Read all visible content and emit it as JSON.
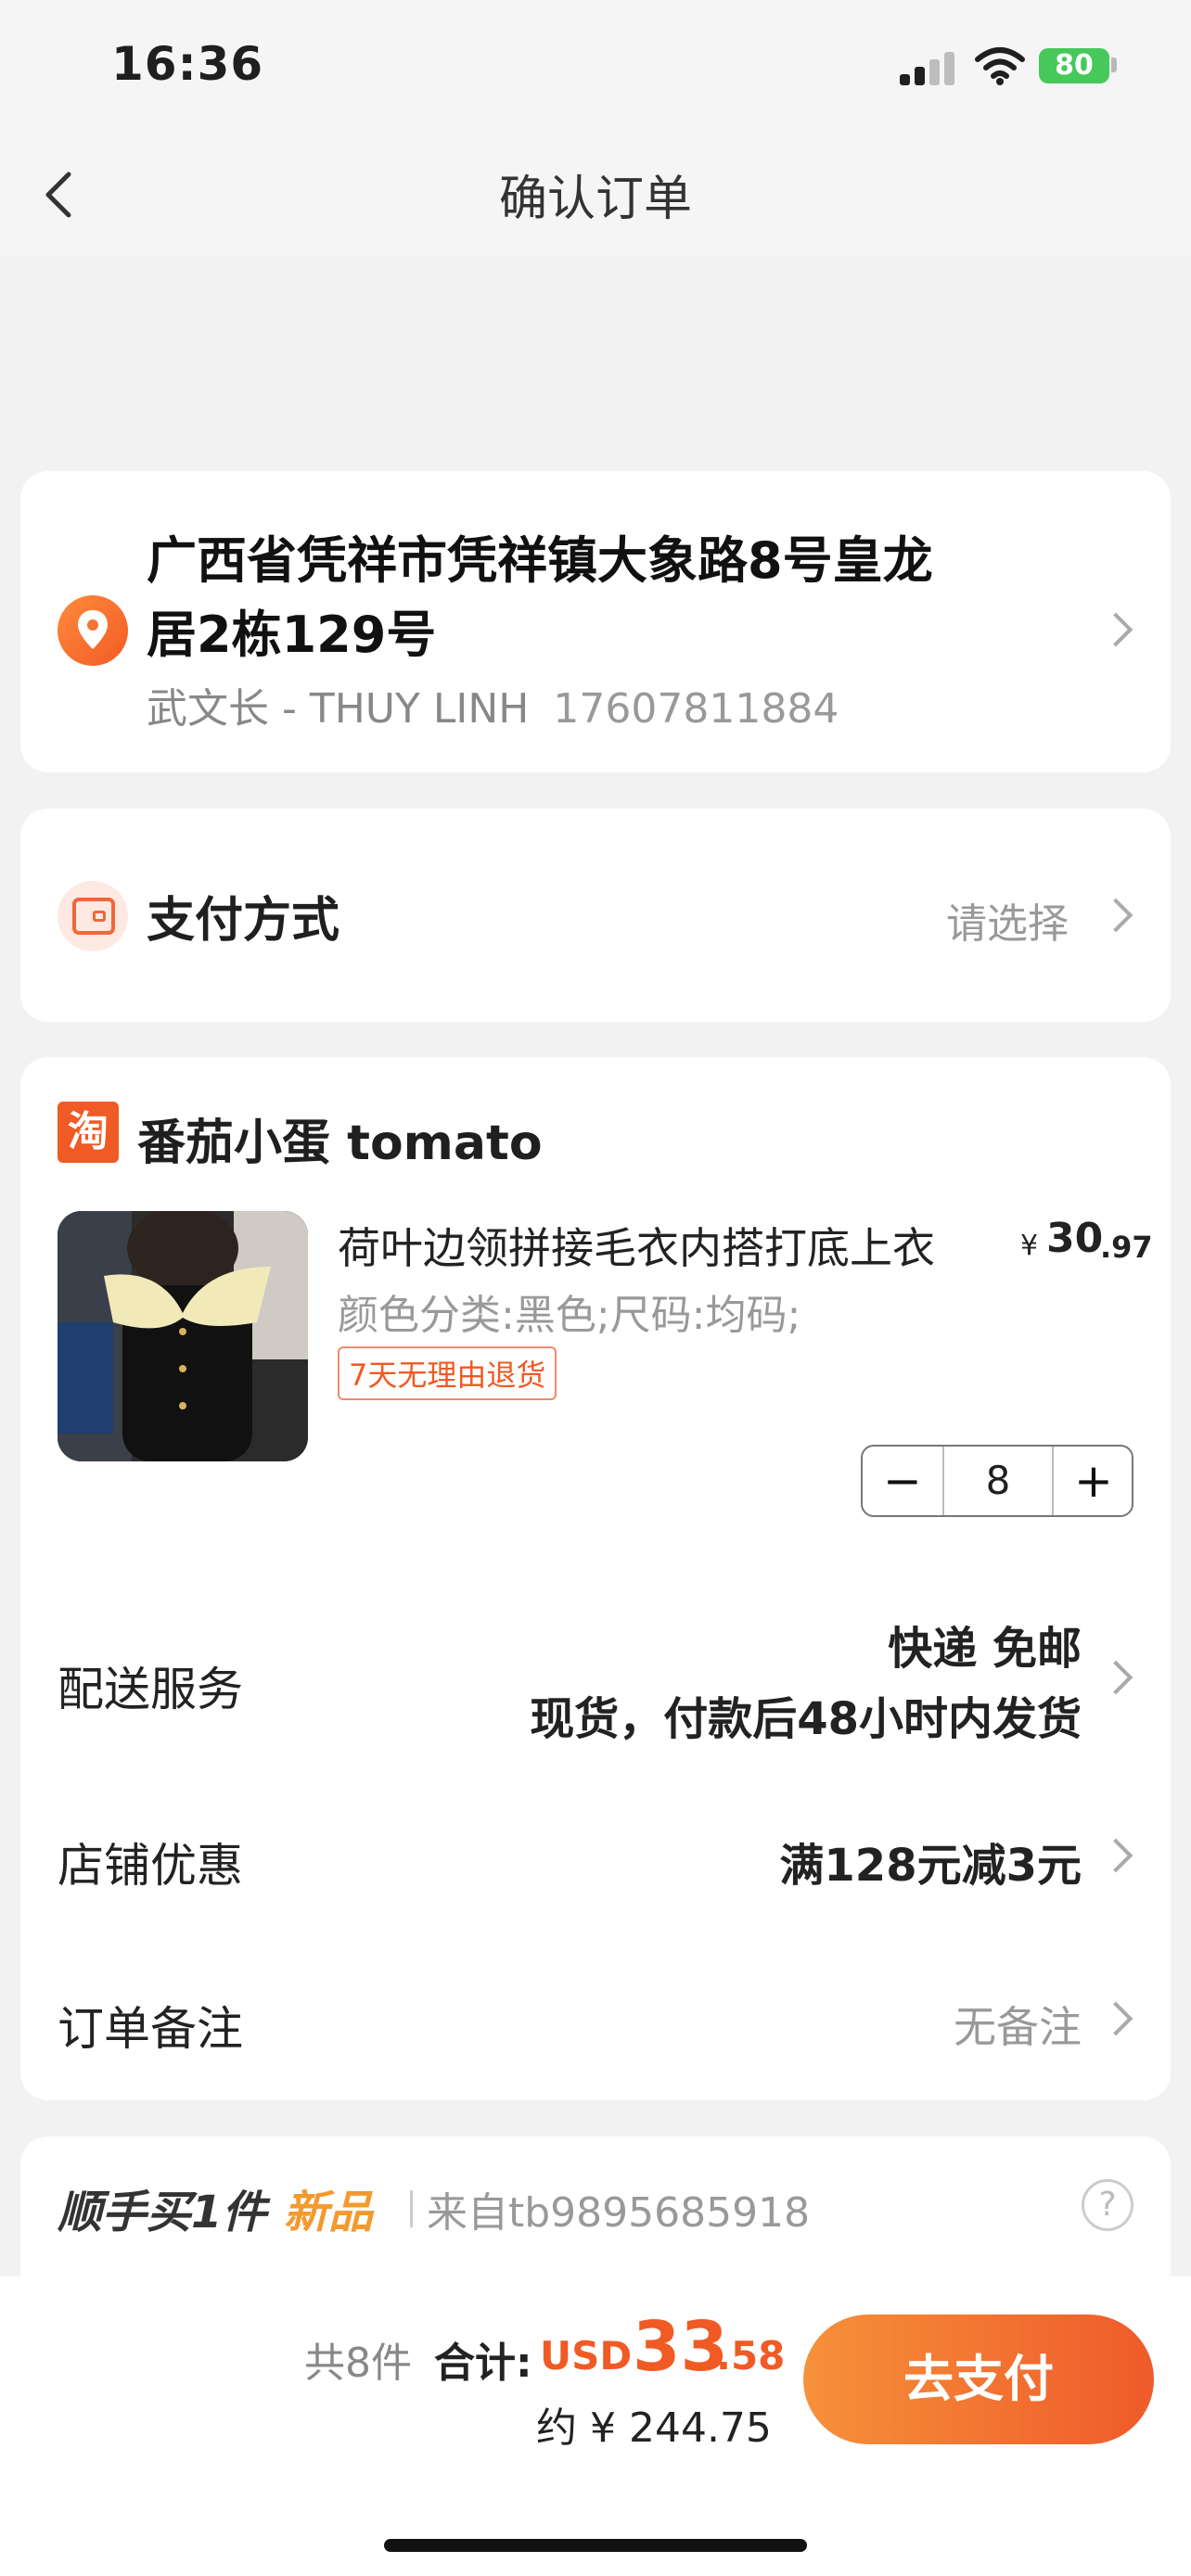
{
  "status_bar": {
    "time": "16:36",
    "battery": "80"
  },
  "nav": {
    "title": "确认订单"
  },
  "address": {
    "line1": "广西省凭祥市凭祥镇大象路8号皇龙",
    "line2": "居2栋129号",
    "recipient": "武文长 - THUY LINH",
    "phone": "17607811884"
  },
  "payment": {
    "label": "支付方式",
    "value": "请选择"
  },
  "shop": {
    "logo_char": "淘",
    "name": "番茄小蛋 tomato",
    "product": {
      "title": "荷叶边领拼接毛衣内搭打底上衣",
      "spec": "颜色分类:黑色;尺码:均码;",
      "tag": "7天无理由退货",
      "price_symbol": "¥",
      "price_int": "30",
      "price_dec": ".97",
      "quantity": "8",
      "minus": "−",
      "plus": "+"
    },
    "delivery": {
      "label": "配送服务",
      "value1": "快递 免邮",
      "value2": "现货，付款后48小时内发货"
    },
    "discount": {
      "label": "店铺优惠",
      "value": "满128元减3元"
    },
    "note": {
      "label": "订单备注",
      "value": "无备注"
    }
  },
  "addon": {
    "main": "顺手买1件",
    "new": "新品",
    "source": "来自tb9895685918",
    "help": "?"
  },
  "bottom": {
    "count": "共8件",
    "total_label": "合计:",
    "currency": "USD",
    "amount_int": "33",
    "amount_dec": ".58",
    "approx": "约 ¥ 244.75",
    "pay_button": "去支付"
  },
  "colors": {
    "accent": "#f05a24",
    "button_start": "#f6913a",
    "button_end": "#ef5a2a",
    "new_tag": "#f29a2e"
  }
}
